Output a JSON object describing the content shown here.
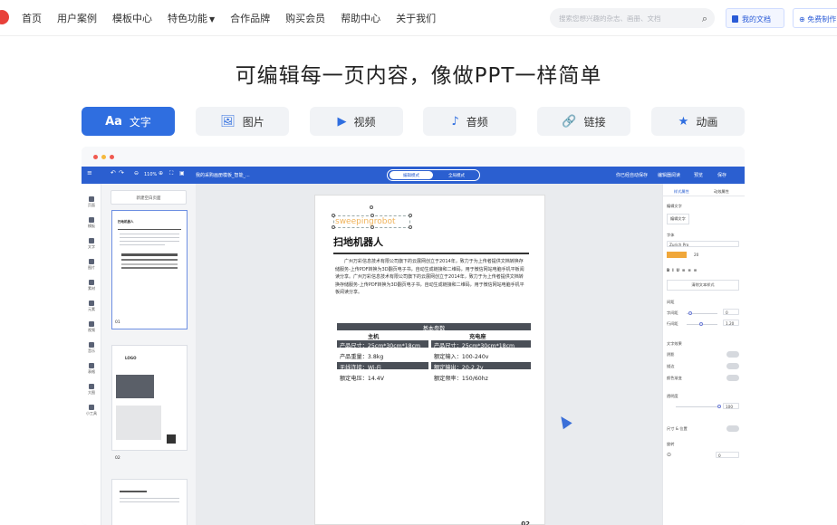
{
  "nav": {
    "items": [
      "首页",
      "用户案例",
      "模板中心",
      "特色功能",
      "合作品牌",
      "购买会员",
      "帮助中心",
      "关于我们"
    ],
    "search_placeholder": "搜索您想兴趣的杂志、画册、文档",
    "my_docs": "我的文档",
    "free_make": "⊕ 免费制作"
  },
  "headline": "可编辑每一页内容，像做PPT一样简单",
  "tabs": [
    {
      "icon": "Aa",
      "label": "文字"
    },
    {
      "icon": "🖼",
      "label": "图片"
    },
    {
      "icon": "▶",
      "label": "视频"
    },
    {
      "icon": "♪",
      "label": "音频"
    },
    {
      "icon": "🔗",
      "label": "链接"
    },
    {
      "icon": "★",
      "label": "动画"
    }
  ],
  "editor": {
    "toolbar": {
      "zoom": "110%",
      "doc_title": "我的采购画册模板_智能_...",
      "mode_edit": "编辑模式",
      "mode_preview": "全局模式",
      "status": "你已经自动保存",
      "btn_read": "编辑器阅读",
      "btn_preview": "预览",
      "btn_save": "保存"
    },
    "left_tools": [
      "页面",
      "模板",
      "文字",
      "图片",
      "素材",
      "元素",
      "视频",
      "音乐",
      "表格",
      "大图",
      "小工具"
    ],
    "new_page": "新建空白页面",
    "thumb1_no": "01",
    "thumb2_no": "02",
    "thumb2_logo": "LOGO",
    "page": {
      "watermark": "sweepingrobot",
      "title": "扫地机器人",
      "intro": "广州万彩信息技术有限公司旗下的云展网创立于2014年，致力于为上传者提供文档转换存储服务-上传PDF转换为3D翻页电子书，自动生成链接和二维码，用于微信网站电脑手机平板阅读分享。广州万彩信息技术有限公司旗下的云展网创立于2014年，致力于为上传者提供文档转换存储服务-上传PDF转换为3D翻页电子书，自动生成链接和二维码，用于微信网站电脑手机平板阅读分享。",
      "spec_header": "基本参数",
      "col_host": "主机",
      "col_dock": "充电座",
      "rows": [
        [
          "产品尺寸：25cm*30cm*18cm",
          "产品尺寸：25cm*30cm*18cm"
        ],
        [
          "产品重量：3.8kg",
          "额定输入：100-240v"
        ],
        [
          "无线连接：Wi-Fi",
          "额定输出：20-2.2v"
        ],
        [
          "额定电压：14.4V",
          "额定频率：150/60hz"
        ]
      ],
      "page_no": "02"
    },
    "panel": {
      "tab_style": "样式属性",
      "tab_anim": "动效属性",
      "edit_text": "编辑文字",
      "edit_text_btn": "编辑文字",
      "font_label": "字体",
      "font_value": "Zurich Pro",
      "size": "20",
      "clear_format": "清除文本样式",
      "spacing": "间距",
      "char_spacing": "字间距",
      "char_val": "0",
      "line_spacing": "行间距",
      "line_val": "1.20",
      "text_effects": "文字效果",
      "shadow": "阴影",
      "stroke": "描边",
      "gradient": "颜色渐变",
      "opacity": "透明度",
      "opacity_val": "100",
      "size_pos": "尺寸 & 位置",
      "rotate": "旋转",
      "rotate_val": "0"
    }
  },
  "colors": {
    "accent": "#2f6ee0",
    "toolbar": "#2b5fd0",
    "watermark": "#f0b35a"
  }
}
